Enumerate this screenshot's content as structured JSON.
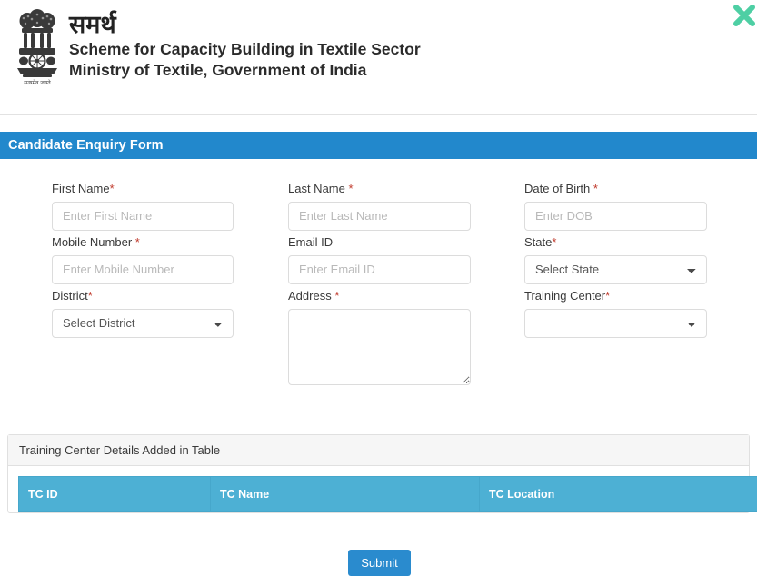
{
  "header": {
    "emblem_name": "ashoka-lion-capital-emblem",
    "emblem_motto": "सत्यमेव जयते",
    "scheme_hindi": "समर्थ",
    "scheme_line1": "Scheme for Capacity Building in Textile Sector",
    "scheme_line2": "Ministry of Textile, Government of India",
    "close_label": "×",
    "close_color": "#4ecfa4"
  },
  "form": {
    "title": "Candidate Enquiry Form",
    "title_bar_color": "#2288cc",
    "fields": {
      "first_name": {
        "label": "First Name",
        "required_mark": "*",
        "placeholder": "Enter First Name",
        "value": ""
      },
      "last_name": {
        "label": "Last Name ",
        "required_mark": "*",
        "placeholder": "Enter Last Name",
        "value": ""
      },
      "date_of_birth": {
        "label": "Date of Birth ",
        "required_mark": "*",
        "placeholder": "Enter DOB",
        "value": ""
      },
      "mobile_number": {
        "label": "Mobile Number ",
        "required_mark": "*",
        "placeholder": "Enter Mobile Number",
        "value": ""
      },
      "email_id": {
        "label": "Email ID",
        "required_mark": "",
        "placeholder": "Enter Email ID",
        "value": ""
      },
      "state": {
        "label": "State",
        "required_mark": "*",
        "selected": "Select State"
      },
      "district": {
        "label": "District",
        "required_mark": "*",
        "selected": "Select District"
      },
      "address": {
        "label": "Address ",
        "required_mark": "*",
        "placeholder": "",
        "value": ""
      },
      "training_center": {
        "label": "Training Center",
        "required_mark": "*",
        "selected": ""
      }
    },
    "submit_label": "Submit",
    "submit_color": "#2a8bce"
  },
  "table_panel": {
    "heading": "Training Center Details Added in Table",
    "header_color": "#4db0d4",
    "columns": [
      "TC ID",
      "TC Name",
      "TC Location"
    ],
    "rows": []
  }
}
